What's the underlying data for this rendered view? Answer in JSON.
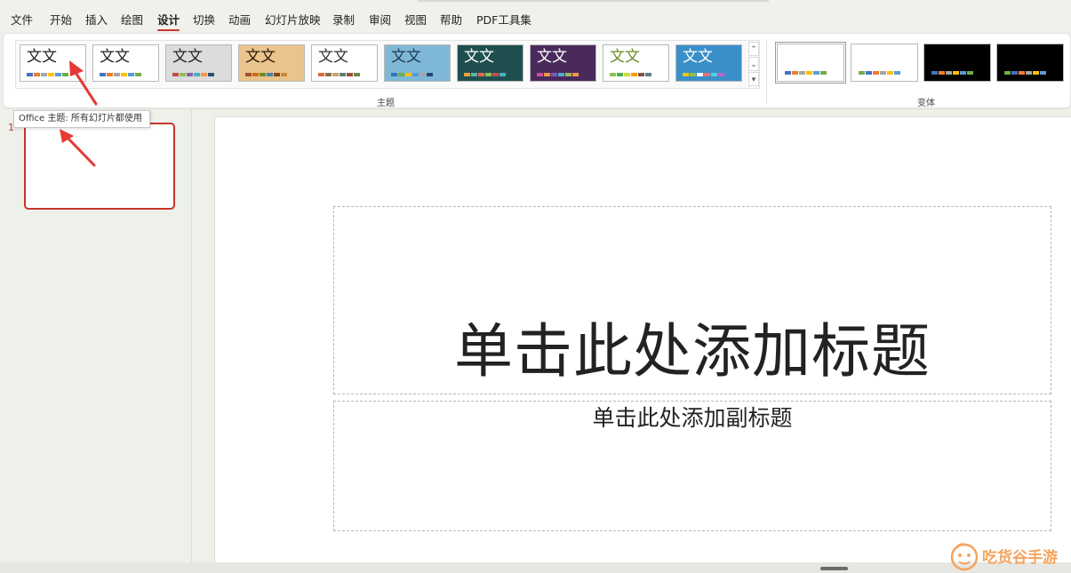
{
  "menu": {
    "items": [
      "文件",
      "开始",
      "插入",
      "绘图",
      "设计",
      "切换",
      "动画",
      "幻灯片放映",
      "录制",
      "审阅",
      "视图",
      "帮助",
      "PDF工具集"
    ],
    "active": "设计"
  },
  "ribbon": {
    "themes_group_label": "主题",
    "variants_group_label": "变体",
    "themes": [
      {
        "name": "office-theme",
        "text": "文文",
        "bg": "#ffffff",
        "text_color": "#222222",
        "swatches": [
          "#4472c4",
          "#ed7d31",
          "#a5a5a5",
          "#ffc000",
          "#5b9bd5",
          "#70ad47"
        ]
      },
      {
        "name": "office-theme-2",
        "text": "文文",
        "bg": "#ffffff",
        "text_color": "#222222",
        "swatches": [
          "#4472c4",
          "#ed7d31",
          "#a5a5a5",
          "#ffc000",
          "#5b9bd5",
          "#70ad47"
        ]
      },
      {
        "name": "gray-theme",
        "text": "文文",
        "bg": "#dcdcdc",
        "text_color": "#222222",
        "swatches": [
          "#c0504d",
          "#9bbb59",
          "#8064a2",
          "#4bacc6",
          "#f79646",
          "#2c4d75"
        ]
      },
      {
        "name": "wood-theme",
        "text": "文文",
        "bg": "#e9c48d",
        "text_color": "#2a1a08",
        "swatches": [
          "#a0522d",
          "#d2691e",
          "#6b8e23",
          "#4682b4",
          "#8b4513",
          "#cd853f"
        ]
      },
      {
        "name": "clean-theme",
        "text": "文文",
        "bg": "#ffffff",
        "text_color": "#333333",
        "swatches": [
          "#e0693b",
          "#8c6d4f",
          "#c9a26b",
          "#5a7d7c",
          "#9e4d3b",
          "#6a8a4c"
        ]
      },
      {
        "name": "pattern-theme",
        "text": "文文",
        "bg": "#7fb8d6",
        "text_color": "#1a3a5a",
        "swatches": [
          "#2e75b6",
          "#70ad47",
          "#ffc000",
          "#5b9bd5",
          "#a5a5a5",
          "#264478"
        ]
      },
      {
        "name": "dark-teal-theme",
        "text": "文文",
        "bg": "#1f4e4f",
        "text_color": "#ffffff",
        "swatches": [
          "#e8a33c",
          "#5db3a4",
          "#e06a4e",
          "#8fbf5a",
          "#c0504d",
          "#4bacc6"
        ]
      },
      {
        "name": "purple-theme",
        "text": "文文",
        "bg": "#4a2a5c",
        "text_color": "#ffffff",
        "swatches": [
          "#c94fa0",
          "#e59b3f",
          "#7a5cb8",
          "#4bacc6",
          "#9bbb59",
          "#f79646"
        ]
      },
      {
        "name": "green-accent-theme",
        "text": "文文",
        "bg": "#ffffff",
        "text_color": "#6b8e23",
        "swatches": [
          "#8bc34a",
          "#4caf50",
          "#cddc39",
          "#ff9800",
          "#795548",
          "#607d8b"
        ]
      },
      {
        "name": "blue-theme",
        "text": "文文",
        "bg": "#3a8fc9",
        "text_color": "#ffffff",
        "swatches": [
          "#f0c419",
          "#8bc34a",
          "#ffffff",
          "#e57373",
          "#4dd0e1",
          "#ba68c8"
        ]
      }
    ],
    "variants": [
      {
        "name": "variant-1",
        "bg": "#ffffff",
        "swatches": [
          "#4472c4",
          "#ed7d31",
          "#a5a5a5",
          "#ffc000",
          "#5b9bd5",
          "#70ad47"
        ]
      },
      {
        "name": "variant-2",
        "bg": "#ffffff",
        "swatches": [
          "#70ad47",
          "#4472c4",
          "#ed7d31",
          "#a5a5a5",
          "#ffc000",
          "#5b9bd5"
        ]
      },
      {
        "name": "variant-3",
        "bg": "#000000",
        "swatches": [
          "#4472c4",
          "#ed7d31",
          "#a5a5a5",
          "#ffc000",
          "#5b9bd5",
          "#70ad47"
        ]
      },
      {
        "name": "variant-4",
        "bg": "#000000",
        "swatches": [
          "#70ad47",
          "#4472c4",
          "#ed7d31",
          "#a5a5a5",
          "#ffc000",
          "#5b9bd5"
        ]
      }
    ]
  },
  "tooltip": "Office 主题: 所有幻灯片都使用",
  "slides": {
    "current_number": "1"
  },
  "slide": {
    "title_placeholder": "单击此处添加标题",
    "subtitle_placeholder": "单击此处添加副标题"
  },
  "watermark": {
    "text": "吃货谷手游"
  },
  "colors": {
    "accent": "#c4372a",
    "arrow": "#e53935",
    "watermark": "#f5a25d"
  }
}
